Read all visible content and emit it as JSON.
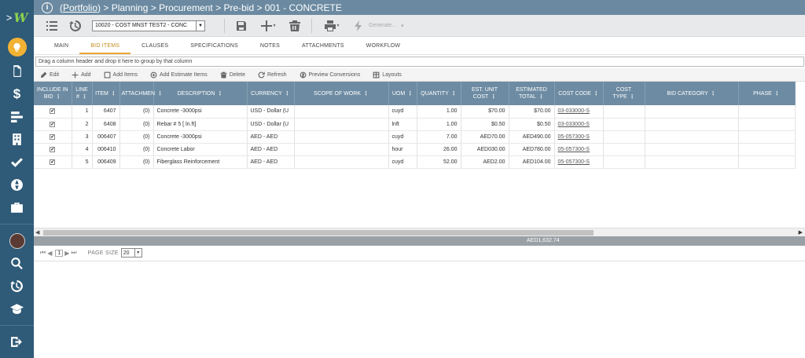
{
  "app": {
    "logo_arrow": ">",
    "logo_mark": "W"
  },
  "breadcrumb": {
    "portfolio": "(Portfolio)",
    "rest": " > Planning > Procurement > Pre-bid > 001 - CONCRETE"
  },
  "toolbar": {
    "project_select": "10020 -  COST MNST TEST2 -  CONC",
    "generate_label": "Generate..."
  },
  "tabs": [
    "MAIN",
    "BID ITEMS",
    "CLAUSES",
    "SPECIFICATIONS",
    "NOTES",
    "ATTACHMENTS",
    "WORKFLOW"
  ],
  "active_tab": "BID ITEMS",
  "group_hint": "Drag a column header and drop it here to group by that column",
  "grid_toolbar": {
    "edit": "Edit",
    "add": "Add",
    "add_items": "Add Items",
    "add_estimate_items": "Add Estimate Items",
    "delete": "Delete",
    "refresh": "Refresh",
    "preview_conversions": "Preview Conversions",
    "layouts": "Layouts"
  },
  "columns": [
    {
      "label": "INCLUDE IN BID",
      "dots": true
    },
    {
      "label": "LINE #",
      "dots": true
    },
    {
      "label": "ITEM",
      "dots": true
    },
    {
      "label": "ATTACHMEN",
      "dots": true
    },
    {
      "label": "DESCRIPTION",
      "dots": true
    },
    {
      "label": "CURRENCY",
      "dots": true
    },
    {
      "label": "SCOPE OF WORK",
      "dots": true
    },
    {
      "label": "UOM",
      "dots": true
    },
    {
      "label": "QUANTITY",
      "dots": true
    },
    {
      "label": "EST. UNIT COST",
      "dots": true
    },
    {
      "label": "ESTIMATED TOTAL",
      "dots": true
    },
    {
      "label": "COST CODE",
      "dots": true
    },
    {
      "label": "COST TYPE",
      "dots": true
    },
    {
      "label": "BID CATEGORY",
      "dots": true
    },
    {
      "label": "PHASE",
      "dots": true
    }
  ],
  "rows": [
    {
      "line": "1",
      "item": "6407",
      "att": "(0)",
      "desc": "Concrete -3000psi",
      "currency": "USD - Dollar (U",
      "scope": "",
      "uom": "cuyd",
      "qty": "1.00",
      "unit_cost": "$70.00",
      "total": "$70.00",
      "cost_code": "03-033000-S",
      "cost_type": "",
      "bid_cat": "",
      "phase": ""
    },
    {
      "line": "2",
      "item": "6408",
      "att": "(0)",
      "desc": "Rebar # 5 [ ln.ft]",
      "currency": "USD - Dollar (U",
      "scope": "",
      "uom": "lnft",
      "qty": "1.00",
      "unit_cost": "$0.50",
      "total": "$0.50",
      "cost_code": "03-033000-S",
      "cost_type": "",
      "bid_cat": "",
      "phase": ""
    },
    {
      "line": "3",
      "item": "006407",
      "att": "(0)",
      "desc": "Concrete -3000psi",
      "currency": "AED - AED",
      "scope": "",
      "uom": "cuyd",
      "qty": "7.00",
      "unit_cost": "AED70.00",
      "total": "AED490.00",
      "cost_code": "05-057300-S",
      "cost_type": "",
      "bid_cat": "",
      "phase": ""
    },
    {
      "line": "4",
      "item": "006410",
      "att": "(0)",
      "desc": "Concrete Labor",
      "currency": "AED - AED",
      "scope": "",
      "uom": "hour",
      "qty": "26.00",
      "unit_cost": "AED030.00",
      "total": "AED780.00",
      "cost_code": "05-057300-S",
      "cost_type": "",
      "bid_cat": "",
      "phase": ""
    },
    {
      "line": "5",
      "item": "006409",
      "att": "(0)",
      "desc": "Fiberglass Reinforcement",
      "currency": "AED - AED",
      "scope": "",
      "uom": "cuyd",
      "qty": "52.00",
      "unit_cost": "AED2.00",
      "total": "AED104.00",
      "cost_code": "05-057300-S",
      "cost_type": "",
      "bid_cat": "",
      "phase": ""
    }
  ],
  "grand_total": "AED1,632.74",
  "pager": {
    "current_page": "1",
    "page_size_label": "PAGE SIZE",
    "page_size": "20"
  },
  "colors": {
    "sidebar": "#2f5a78",
    "header": "#6d8ba2",
    "accent": "#e9a436",
    "bulb": "#f2b233"
  }
}
